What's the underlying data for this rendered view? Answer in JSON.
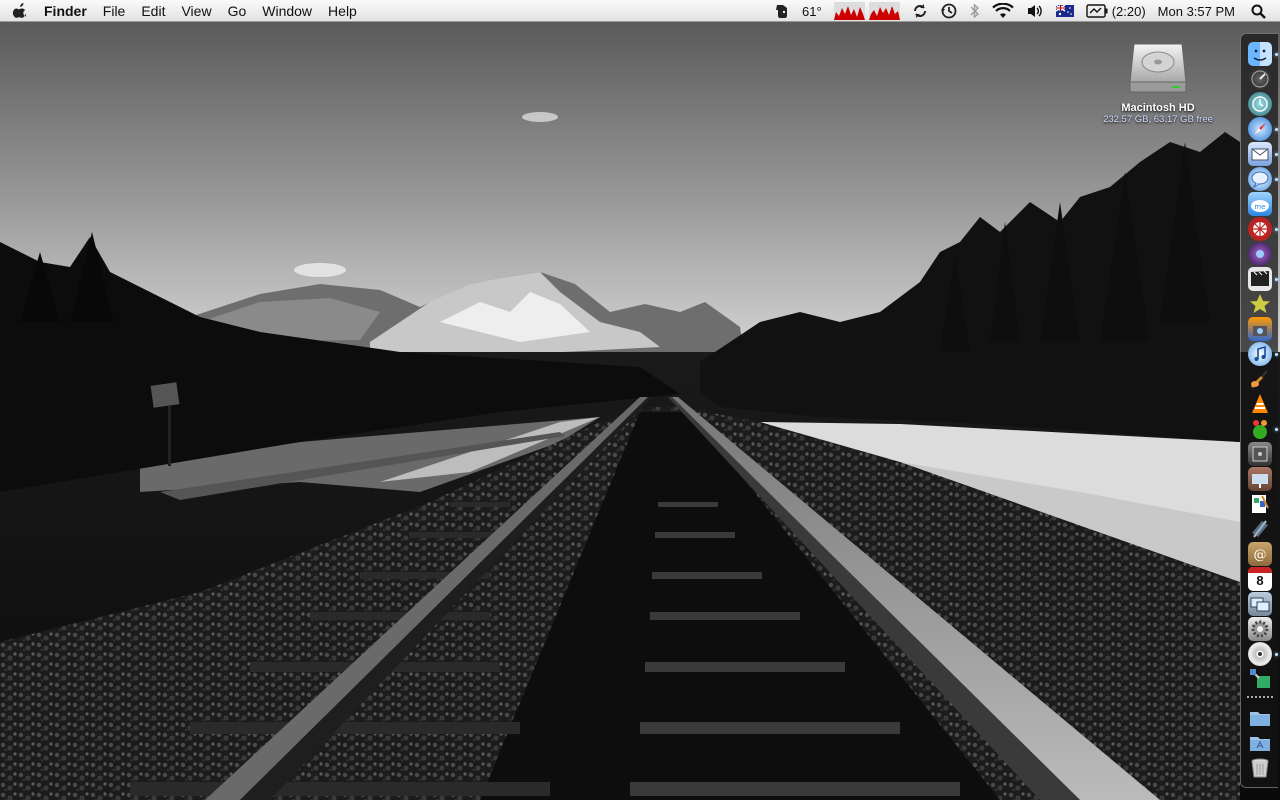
{
  "menubar": {
    "app_name": "Finder",
    "menus": [
      "File",
      "Edit",
      "View",
      "Go",
      "Window",
      "Help"
    ],
    "temperature": "61°",
    "battery_time": "(2:20)",
    "clock": "Mon 3:57 PM"
  },
  "desktop": {
    "drive_name": "Macintosh HD",
    "drive_info": "232.57 GB, 63.17 GB free"
  },
  "dock": {
    "calendar_day": "8",
    "items": [
      "finder-icon",
      "dashboard-icon",
      "time-machine-icon",
      "safari-icon",
      "mail-icon",
      "ichat-icon",
      "mobileme-icon",
      "lost-icon",
      "front-row-icon",
      "imovie-icon",
      "iphoto-icon",
      "itunes-icon",
      "garageband-icon",
      "vlc-icon",
      "adium-icon",
      "disk-utility-icon",
      "keynote-icon",
      "pages-icon",
      "script-editor-icon",
      "address-book-icon",
      "ical-icon",
      "screen-sharing-icon",
      "system-preferences-icon",
      "dvd-player-icon",
      "app-icon",
      "downloads-folder-icon",
      "applications-folder-icon",
      "trash-icon"
    ]
  }
}
